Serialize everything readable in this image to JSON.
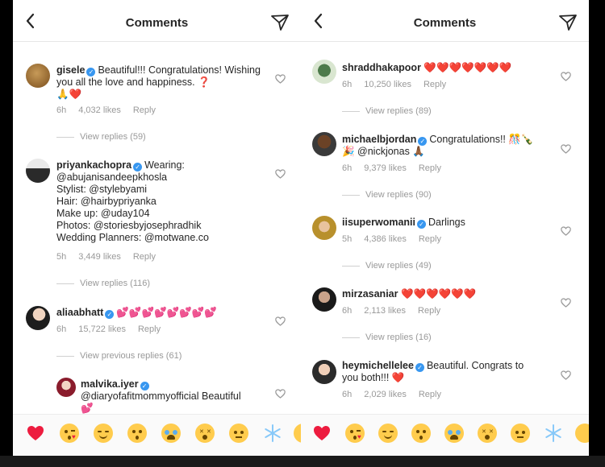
{
  "left": {
    "title": "Comments",
    "comments": [
      {
        "user": "gisele",
        "text": "Beautiful!!! Congratulations! Wishing you all the love and happiness. ❓",
        "text2": "🙏❤️",
        "time": "6h",
        "likes": "4,032 likes",
        "reply": "Reply",
        "replies": "View replies (59)"
      },
      {
        "user": "priyankachopra",
        "text": "Wearing: @abujanisandeepkhosla",
        "line2": "Stylist: @stylebyami",
        "line3": "Hair: @hairbypriyanka",
        "line4": "Make up: @uday104",
        "line5": "Photos: @storiesbyjosephradhik",
        "line6": "Wedding Planners: @motwane.co",
        "time": "5h",
        "likes": "3,449 likes",
        "reply": "Reply",
        "replies": "View replies (116)"
      },
      {
        "user": "aliaabhatt",
        "text": "💕💕💕💕💕💕💕💕",
        "time": "6h",
        "likes": "15,722 likes",
        "reply": "Reply",
        "replies": "View previous replies (61)"
      },
      {
        "user": "malvika.iyer",
        "text": "@diaryofafitmommyofficial Beautiful",
        "text2": "💕"
      }
    ]
  },
  "right": {
    "title": "Comments",
    "comments": [
      {
        "user": "shraddhakapoor",
        "text": "❤️❤️❤️❤️❤️❤️❤️",
        "time": "6h",
        "likes": "10,250 likes",
        "reply": "Reply",
        "replies": "View replies (89)"
      },
      {
        "user": "michaelbjordan",
        "text": "Congratulations!! 🎊🍾",
        "text2": "🎉 @nickjonas 🙏🏾",
        "time": "6h",
        "likes": "9,379 likes",
        "reply": "Reply",
        "replies": "View replies (90)"
      },
      {
        "user": "iisuperwomanii",
        "text": "Darlings",
        "time": "5h",
        "likes": "4,386 likes",
        "reply": "Reply",
        "replies": "View replies (49)"
      },
      {
        "user": "mirzasaniar",
        "text": "❤️❤️❤️❤️❤️❤️",
        "time": "6h",
        "likes": "2,113 likes",
        "reply": "Reply",
        "replies": "View replies (16)"
      },
      {
        "user": "heymichellelee",
        "text": "Beautiful. Congrats to",
        "text2": "you both!!! ❤️",
        "time": "6h",
        "likes": "2,029 likes",
        "reply": "Reply"
      }
    ]
  },
  "emoji_bar": [
    "heart",
    "kiss",
    "smiling",
    "kissing",
    "crying",
    "astonished",
    "neutral",
    "snowflake",
    "hidden"
  ],
  "colors": {
    "verified": "#3897f0",
    "heart": "#ed1c3f",
    "meta": "#999999",
    "emoji_yellow": "#ffcc4d"
  }
}
